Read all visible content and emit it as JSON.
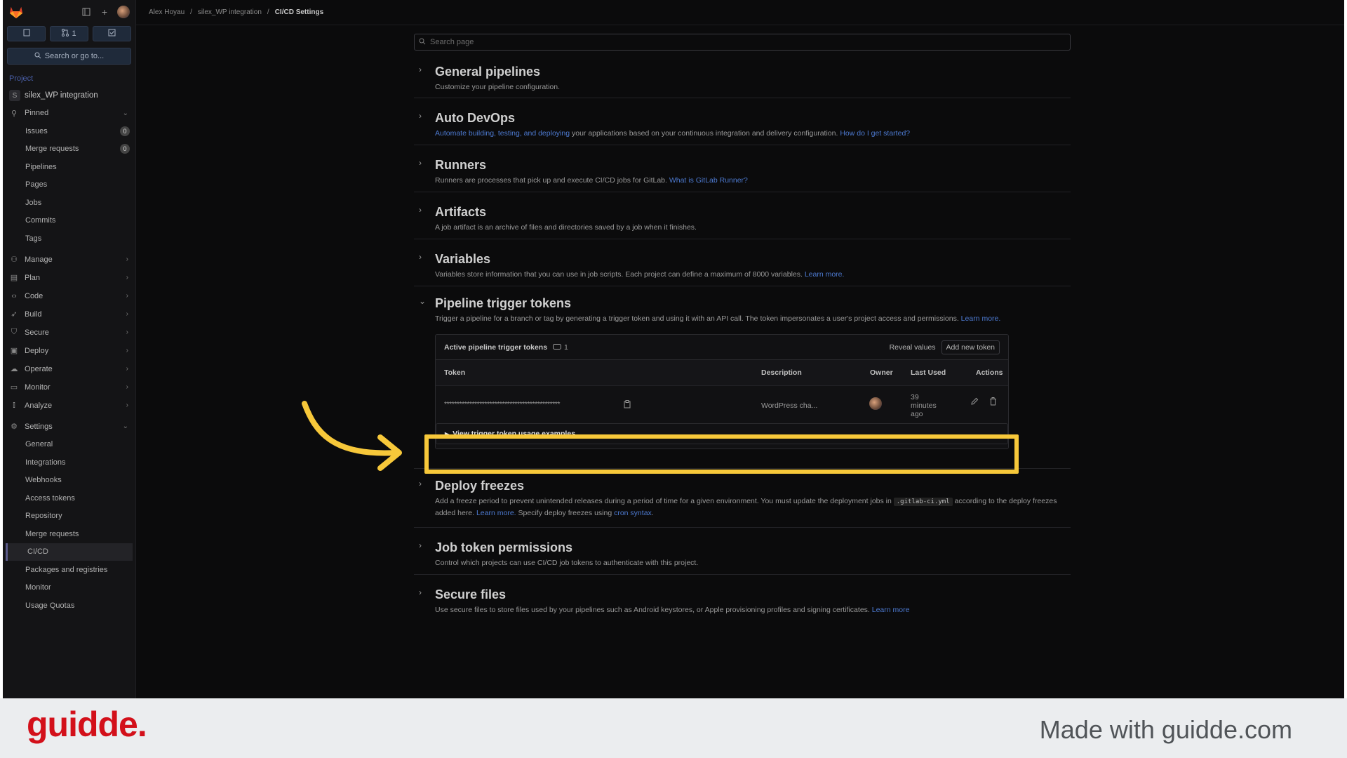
{
  "sidebar": {
    "merge_count": "1",
    "search_label": "Search or go to...",
    "section_label": "Project",
    "project": {
      "initial": "S",
      "name": "silex_WP integration"
    },
    "pinned_label": "Pinned",
    "pinned_items": [
      {
        "label": "Issues",
        "badge": "0"
      },
      {
        "label": "Merge requests",
        "badge": "0"
      },
      {
        "label": "Pipelines"
      },
      {
        "label": "Pages"
      },
      {
        "label": "Jobs"
      },
      {
        "label": "Commits"
      },
      {
        "label": "Tags"
      }
    ],
    "groups": [
      "Manage",
      "Plan",
      "Code",
      "Build",
      "Secure",
      "Deploy",
      "Operate",
      "Monitor",
      "Analyze"
    ],
    "settings_label": "Settings",
    "settings_items": [
      "General",
      "Integrations",
      "Webhooks",
      "Access tokens",
      "Repository",
      "Merge requests",
      "CI/CD",
      "Packages and registries",
      "Monitor",
      "Usage Quotas"
    ],
    "active_item": "CI/CD"
  },
  "breadcrumb": {
    "user": "Alex Hoyau",
    "project": "silex_WP integration",
    "current": "CI/CD Settings"
  },
  "search": {
    "placeholder": "Search page"
  },
  "sections": {
    "general": {
      "title": "General pipelines",
      "desc": "Customize your pipeline configuration."
    },
    "autodevops": {
      "title": "Auto DevOps",
      "link1": "Automate building, testing, and deploying",
      "desc": " your applications based on your continuous integration and delivery configuration. ",
      "link2": "How do I get started?"
    },
    "runners": {
      "title": "Runners",
      "desc": "Runners are processes that pick up and execute CI/CD jobs for GitLab. ",
      "link": "What is GitLab Runner?"
    },
    "artifacts": {
      "title": "Artifacts",
      "desc": "A job artifact is an archive of files and directories saved by a job when it finishes."
    },
    "variables": {
      "title": "Variables",
      "desc": "Variables store information that you can use in job scripts. Each project can define a maximum of 8000 variables. ",
      "link": "Learn more."
    },
    "trigger": {
      "title": "Pipeline trigger tokens",
      "desc": "Trigger a pipeline for a branch or tag by generating a trigger token and using it with an API call. The token impersonates a user's project access and permissions. ",
      "link": "Learn more.",
      "card_title": "Active pipeline trigger tokens",
      "count": "1",
      "reveal": "Reveal values",
      "add": "Add new token",
      "columns": {
        "token": "Token",
        "description": "Description",
        "owner": "Owner",
        "last_used": "Last Used",
        "actions": "Actions"
      },
      "row": {
        "token": "**********************************************",
        "description": "WordPress cha...",
        "last_used": "39 minutes ago"
      },
      "details_label": "View trigger token usage examples"
    },
    "freezes": {
      "title": "Deploy freezes",
      "desc1": "Add a freeze period to prevent unintended releases during a period of time for a given environment. You must update the deployment jobs in ",
      "code": ".gitlab-ci.yml",
      "desc2": " according to the deploy freezes added here. ",
      "link1": "Learn more.",
      "desc3": " Specify deploy freezes using ",
      "link2": "cron syntax",
      "desc4": "."
    },
    "jobtoken": {
      "title": "Job token permissions",
      "desc": "Control which projects can use CI/CD job tokens to authenticate with this project."
    },
    "securefiles": {
      "title": "Secure files",
      "desc": "Use secure files to store files used by your pipelines such as Android keystores, or Apple provisioning profiles and signing certificates. ",
      "link": "Learn more"
    }
  },
  "footer": {
    "brand": "guidde.",
    "tagline": "Made with guidde.com"
  },
  "colors": {
    "highlight": "#f7c83a",
    "brand": "#d3101a",
    "link": "#4d7ad1"
  }
}
